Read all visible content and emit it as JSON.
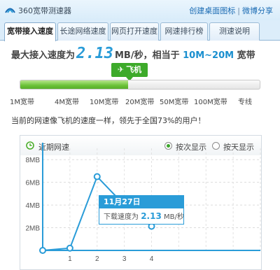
{
  "app": {
    "title": "360宽带测速器",
    "action_create_icon": "创建桌面图标",
    "action_separator": "|",
    "action_share": "微博分享"
  },
  "tabs": [
    {
      "label": "宽带接入速度",
      "active": true
    },
    {
      "label": "长途网络速度",
      "active": false
    },
    {
      "label": "网页打开速度",
      "active": false
    },
    {
      "label": "网速排行榜",
      "active": false
    },
    {
      "label": "测速说明",
      "active": false
    }
  ],
  "result": {
    "prefix": "最大接入速度为",
    "value": "2.13",
    "unit": "MB/秒",
    "mid": "，相当于",
    "range": "10M~20M",
    "suffix": "宽带"
  },
  "badge": {
    "icon": "airplane-icon",
    "label": "飞机"
  },
  "speed_bar": {
    "fill_fraction": 0.45,
    "labels": [
      "1M宽带",
      "4M宽带",
      "10M宽带",
      "20M宽带",
      "50M宽带",
      "100M宽带",
      "专线"
    ]
  },
  "rank_text": "当前的网速像飞机的速度一样，领先于全国73%的用户！",
  "chart_panel": {
    "title": "近期网速",
    "radio_by_count": "按次显示",
    "radio_by_day": "按天显示",
    "selected": "by_count"
  },
  "tooltip": {
    "date": "11月27日",
    "label": "下载速度为",
    "value": "2.13",
    "unit": "MB/秒"
  },
  "colors": {
    "accent": "#2a9cd8",
    "bar_green": "#6ac238",
    "badge_green": "#3daa2a"
  },
  "chart_data": {
    "type": "line",
    "title": "近期网速",
    "x": [
      0,
      1,
      2,
      3,
      4
    ],
    "categories": [
      "",
      "1",
      "2",
      "3",
      "4"
    ],
    "series": [
      {
        "values": [
          0,
          0.2,
          6.5,
          4.0,
          2.13
        ]
      }
    ],
    "yticks": [
      "2MB",
      "4MB",
      "6MB",
      "8MB"
    ],
    "ytick_values": [
      2,
      4,
      6,
      8
    ],
    "ylim": [
      0,
      9
    ],
    "xlim": [
      0,
      8
    ],
    "grid": true
  }
}
